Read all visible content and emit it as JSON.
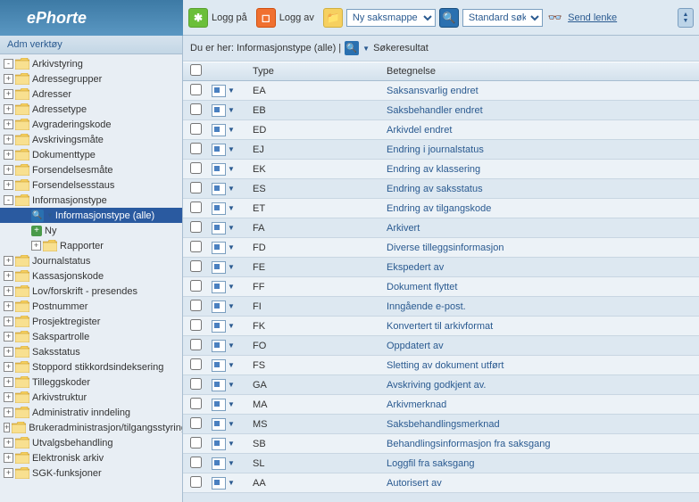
{
  "logo": "ePhorte",
  "toolbar": {
    "logon": "Logg på",
    "logoff": "Logg av",
    "newcase_select": "Ny saksmappe",
    "search_select": "Standard søk",
    "sendlink": "Send lenke"
  },
  "sidebar": {
    "title": "Adm verktøy",
    "items": [
      {
        "label": "Arkivstyring",
        "exp": "-"
      },
      {
        "label": "Adressegrupper",
        "exp": "+"
      },
      {
        "label": "Adresser",
        "exp": "+"
      },
      {
        "label": "Adressetype",
        "exp": "+"
      },
      {
        "label": "Avgraderingskode",
        "exp": "+"
      },
      {
        "label": "Avskrivingsmåte",
        "exp": "+"
      },
      {
        "label": "Dokumenttype",
        "exp": "+"
      },
      {
        "label": "Forsendelsesmåte",
        "exp": "+"
      },
      {
        "label": "Forsendelsesstaus",
        "exp": "+"
      },
      {
        "label": "Informasjonstype",
        "exp": "-",
        "children": [
          {
            "label": "Informasjonstype (alle)",
            "selected": true,
            "kind": "search"
          },
          {
            "label": "Ny",
            "kind": "new"
          },
          {
            "label": "Rapporter",
            "exp": "+"
          }
        ]
      },
      {
        "label": "Journalstatus",
        "exp": "+"
      },
      {
        "label": "Kassasjonskode",
        "exp": "+"
      },
      {
        "label": "Lov/forskrift - presendes",
        "exp": "+"
      },
      {
        "label": "Postnummer",
        "exp": "+"
      },
      {
        "label": "Prosjektregister",
        "exp": "+"
      },
      {
        "label": "Sakspartrolle",
        "exp": "+"
      },
      {
        "label": "Saksstatus",
        "exp": "+"
      },
      {
        "label": "Stoppord stikkordsindeksering",
        "exp": "+"
      },
      {
        "label": "Tilleggskoder",
        "exp": "+"
      },
      {
        "label": "Arkivstruktur",
        "exp": "+"
      },
      {
        "label": "Administrativ inndeling",
        "exp": "+"
      },
      {
        "label": "Brukeradministrasjon/tilgangsstyring",
        "exp": "+"
      },
      {
        "label": "Utvalgsbehandling",
        "exp": "+"
      },
      {
        "label": "Elektronisk arkiv",
        "exp": "+"
      },
      {
        "label": "SGK-funksjoner",
        "exp": "+"
      }
    ]
  },
  "breadcrumb": {
    "prefix": "Du er her: Informasjonstype (alle) |",
    "result": "Søkeresultat"
  },
  "grid": {
    "headers": {
      "type": "Type",
      "desc": "Betegnelse"
    },
    "rows": [
      {
        "type": "EA",
        "desc": "Saksansvarlig endret"
      },
      {
        "type": "EB",
        "desc": "Saksbehandler endret"
      },
      {
        "type": "ED",
        "desc": "Arkivdel endret"
      },
      {
        "type": "EJ",
        "desc": "Endring i journalstatus"
      },
      {
        "type": "EK",
        "desc": "Endring av klassering"
      },
      {
        "type": "ES",
        "desc": "Endring av saksstatus"
      },
      {
        "type": "ET",
        "desc": "Endring av tilgangskode"
      },
      {
        "type": "FA",
        "desc": "Arkivert"
      },
      {
        "type": "FD",
        "desc": "Diverse tilleggsinformasjon"
      },
      {
        "type": "FE",
        "desc": "Ekspedert av"
      },
      {
        "type": "FF",
        "desc": "Dokument flyttet"
      },
      {
        "type": "FI",
        "desc": "Inngående e-post."
      },
      {
        "type": "FK",
        "desc": "Konvertert til arkivformat"
      },
      {
        "type": "FO",
        "desc": "Oppdatert av"
      },
      {
        "type": "FS",
        "desc": "Sletting av dokument utført"
      },
      {
        "type": "GA",
        "desc": "Avskriving godkjent av."
      },
      {
        "type": "MA",
        "desc": "Arkivmerknad"
      },
      {
        "type": "MS",
        "desc": "Saksbehandlingsmerknad"
      },
      {
        "type": "SB",
        "desc": "Behandlingsinformasjon fra saksgang"
      },
      {
        "type": "SL",
        "desc": "Loggfil fra saksgang"
      },
      {
        "type": "AA",
        "desc": "Autorisert av"
      }
    ]
  }
}
